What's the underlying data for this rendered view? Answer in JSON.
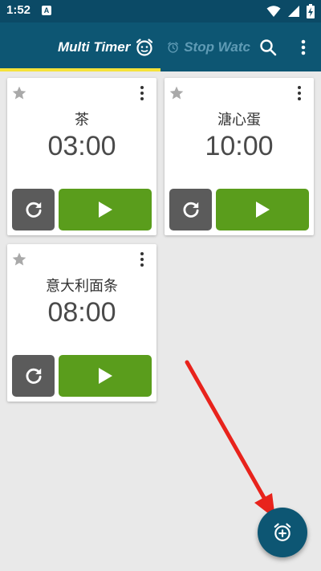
{
  "status_bar": {
    "time": "1:52",
    "notification_icon": "A"
  },
  "app_bar": {
    "tabs": [
      {
        "label": "Multi Timer",
        "icon": "alarm-clock-face-icon",
        "selected": true
      },
      {
        "label": "Stop Watc",
        "icon": "alarm-clock-icon",
        "selected": false
      }
    ],
    "indicator_color": "#f5e23a",
    "actions": [
      "search-icon",
      "more-vert-icon"
    ]
  },
  "timers": [
    {
      "name": "茶",
      "time": "03:00"
    },
    {
      "name": "溏心蛋",
      "time": "10:00"
    },
    {
      "name": "意大利面条",
      "time": "08:00"
    }
  ],
  "colors": {
    "primary": "#0d5673",
    "status_bar": "#0b4a66",
    "play_button": "#5a9d1c",
    "reset_button": "#5b5b5b",
    "annotation_arrow": "#e8231c"
  },
  "fab": {
    "icon": "add-alarm-icon"
  }
}
